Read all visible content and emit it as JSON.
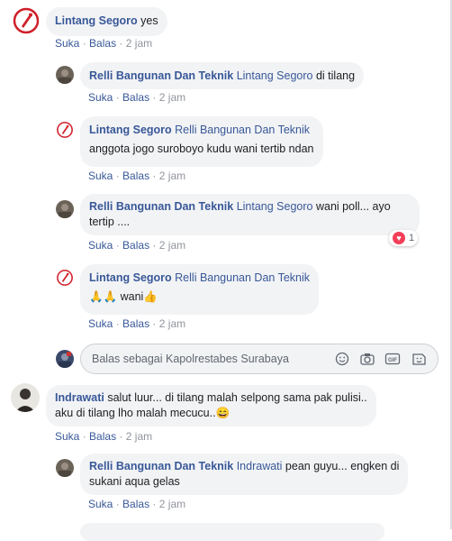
{
  "colors": {
    "link": "#385898",
    "bubble": "#f2f3f5",
    "muted": "#90949c",
    "heart": "#f33e58",
    "logo_red": "#d0202a"
  },
  "actions": {
    "like": "Suka",
    "reply": "Balas",
    "separator": "·"
  },
  "comments": [
    {
      "author": "Lintang Segoro",
      "mention": "",
      "text": "yes",
      "time": "2 jam",
      "avatar": "police-logo-avatar"
    },
    {
      "author": "Relli Bangunan Dan Teknik",
      "mention": "Lintang Segoro",
      "text": "di tilang",
      "time": "2 jam",
      "avatar": "photo-avatar"
    },
    {
      "author": "Lintang Segoro",
      "mention": "Relli Bangunan Dan Teknik",
      "text": "anggota jogo suroboyo kudu wani tertib ndan",
      "time": "2 jam",
      "avatar": "police-logo-avatar"
    },
    {
      "author": "Relli Bangunan Dan Teknik",
      "mention": "Lintang Segoro",
      "text_line1": "wani poll... ayo",
      "text_line2": "tertip ....",
      "time": "2 jam",
      "avatar": "photo-avatar",
      "reaction": {
        "icon": "heart-icon",
        "count": "1"
      }
    },
    {
      "author": "Lintang Segoro",
      "mention": "Relli Bangunan Dan Teknik",
      "text": "🙏🙏 wani👍",
      "time": "2 jam",
      "avatar": "police-logo-avatar"
    },
    {
      "author": "Indrawati",
      "mention": "",
      "text_line1": "salut luur... di tilang malah selpong sama pak pulisi..",
      "text_line2": "aku di tilang lho malah mecucu..😄",
      "time": "2 jam",
      "avatar": "photo-avatar"
    },
    {
      "author": "Relli Bangunan Dan Teknik",
      "mention": "Indrawati",
      "text_line1": "pean guyu... engken di",
      "text_line2": "sukani aqua gelas",
      "time": "2 jam",
      "avatar": "photo-avatar"
    }
  ],
  "reply_box": {
    "placeholder": "Balas sebagai Kapolrestabes Surabaya",
    "icons": [
      "emoji-icon",
      "camera-icon",
      "gif-icon",
      "sticker-icon"
    ],
    "gif_label": "GIF"
  }
}
